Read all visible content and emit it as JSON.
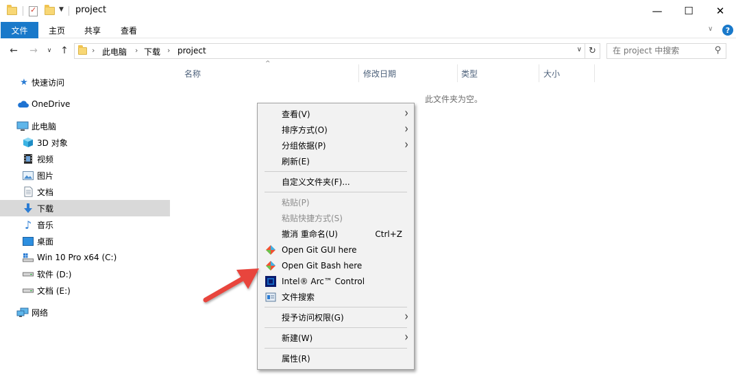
{
  "window": {
    "title": "project",
    "minimize_glyph": "—",
    "maximize_glyph": "☐",
    "close_glyph": "✕"
  },
  "ribbon": {
    "tabs": [
      "文件",
      "主页",
      "共享",
      "查看"
    ],
    "help_glyph": "?"
  },
  "address": {
    "crumbs": [
      "此电脑",
      "下载",
      "project"
    ],
    "search_placeholder": "在 project 中搜索"
  },
  "nav_pane": {
    "items": [
      {
        "label": "快速访问",
        "icon": "quick-access-star-icon"
      },
      {
        "label": "OneDrive",
        "icon": "onedrive-cloud-icon"
      },
      {
        "label": "此电脑",
        "icon": "this-pc-icon"
      },
      {
        "label": "3D 对象",
        "icon": "3d-objects-icon"
      },
      {
        "label": "视频",
        "icon": "videos-icon"
      },
      {
        "label": "图片",
        "icon": "pictures-icon"
      },
      {
        "label": "文档",
        "icon": "documents-icon"
      },
      {
        "label": "下载",
        "icon": "downloads-icon",
        "selected": true
      },
      {
        "label": "音乐",
        "icon": "music-icon"
      },
      {
        "label": "桌面",
        "icon": "desktop-icon"
      },
      {
        "label": "Win 10 Pro x64 (C:)",
        "icon": "drive-c-icon"
      },
      {
        "label": "软件 (D:)",
        "icon": "drive-d-icon"
      },
      {
        "label": "文档 (E:)",
        "icon": "drive-e-icon"
      },
      {
        "label": "网络",
        "icon": "network-icon"
      }
    ]
  },
  "columns": [
    "名称",
    "修改日期",
    "类型",
    "大小"
  ],
  "empty_message": "此文件夹为空。",
  "context_menu": {
    "items": [
      {
        "label": "查看(V)",
        "submenu": true
      },
      {
        "label": "排序方式(O)",
        "submenu": true
      },
      {
        "label": "分组依据(P)",
        "submenu": true
      },
      {
        "label": "刷新(E)"
      },
      {
        "label": "自定义文件夹(F)..."
      },
      {
        "label": "粘贴(P)",
        "disabled": true
      },
      {
        "label": "粘贴快捷方式(S)",
        "disabled": true
      },
      {
        "label": "撤消 重命名(U)",
        "shortcut": "Ctrl+Z"
      },
      {
        "label": "Open Git GUI here",
        "icon": "git-icon"
      },
      {
        "label": "Open Git Bash here",
        "icon": "git-icon"
      },
      {
        "label": "Intel® Arc™ Control",
        "icon": "intel-arc-icon"
      },
      {
        "label": "文件搜索",
        "icon": "file-search-icon"
      },
      {
        "label": "授予访问权限(G)",
        "submenu": true
      },
      {
        "label": "新建(W)",
        "submenu": true
      },
      {
        "label": "属性(R)"
      }
    ]
  },
  "colors": {
    "accent": "#1979ca",
    "selection": "#d9d9d9",
    "arrow": "#e8453c"
  }
}
